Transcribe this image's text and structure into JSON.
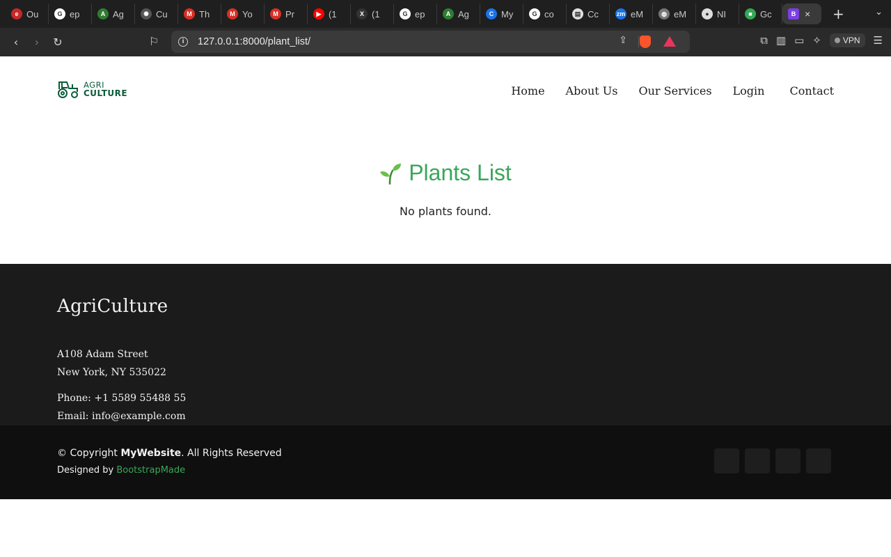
{
  "browser": {
    "tabs": [
      {
        "title": "Ou",
        "icon": "e-icon",
        "color": "#c62828",
        "glyph": "e"
      },
      {
        "title": "ep",
        "icon": "google-icon",
        "color": "#ffffff",
        "glyph": "G"
      },
      {
        "title": "Ag",
        "icon": "agri-icon",
        "color": "#2e7d32",
        "glyph": "A"
      },
      {
        "title": "Cu",
        "icon": "openai-icon",
        "color": "#555555",
        "glyph": "✺"
      },
      {
        "title": "Th",
        "icon": "gmail-icon",
        "color": "#d93025",
        "glyph": "M"
      },
      {
        "title": "Yo",
        "icon": "gmail-icon",
        "color": "#d93025",
        "glyph": "M"
      },
      {
        "title": "Pr",
        "icon": "gmail-icon",
        "color": "#d93025",
        "glyph": "M"
      },
      {
        "title": "(1",
        "icon": "youtube-icon",
        "color": "#ff0000",
        "glyph": "▶"
      },
      {
        "title": "(1",
        "icon": "x-icon",
        "color": "#333333",
        "glyph": "X"
      },
      {
        "title": "ep",
        "icon": "google-icon",
        "color": "#ffffff",
        "glyph": "G"
      },
      {
        "title": "Ag",
        "icon": "agri-icon",
        "color": "#2e7d32",
        "glyph": "A"
      },
      {
        "title": "My",
        "icon": "c-icon",
        "color": "#1a73e8",
        "glyph": "C"
      },
      {
        "title": "co",
        "icon": "google-icon",
        "color": "#ffffff",
        "glyph": "G"
      },
      {
        "title": "Cc",
        "icon": "doc-icon",
        "color": "#e0e0e0",
        "glyph": "▤"
      },
      {
        "title": "eM",
        "icon": "zm-icon",
        "color": "#1a73e8",
        "glyph": "zm"
      },
      {
        "title": "eM",
        "icon": "globe-icon",
        "color": "#777777",
        "glyph": "◍"
      },
      {
        "title": "NI",
        "icon": "github-icon",
        "color": "#dddddd",
        "glyph": "●"
      },
      {
        "title": "Gc",
        "icon": "meet-icon",
        "color": "#34a853",
        "glyph": "■"
      }
    ],
    "active_tab": {
      "title": "B",
      "icon": "bootstrap-icon"
    },
    "url": "127.0.0.1:8000/plant_list/",
    "vpn_label": "VPN"
  },
  "header": {
    "logo": {
      "line1": "AGRI",
      "line2": "CULTURE",
      "color": "#0c5c3a"
    },
    "nav": [
      "Home",
      "About Us",
      "Our Services",
      "Login",
      "Contact"
    ]
  },
  "main": {
    "title_icon": "seedling-icon",
    "title": "Plants List",
    "empty_message": "No plants found.",
    "accent": "#3aa65a"
  },
  "footer": {
    "brand": "AgriCulture",
    "address_line1": "A108 Adam Street",
    "address_line2": "New York, NY 535022",
    "phone_label": "Phone:",
    "phone": "+1 5589 55488 55",
    "email_label": "Email:",
    "email": "info@example.com",
    "copyright_prefix": "© Copyright",
    "copyright_name": "MyWebsite",
    "copyright_suffix": ". All Rights Reserved",
    "designed_by": "Designed by",
    "designer": "BootstrapMade",
    "social_icons": [
      "twitter-icon",
      "facebook-icon",
      "instagram-icon",
      "linkedin-icon"
    ]
  }
}
